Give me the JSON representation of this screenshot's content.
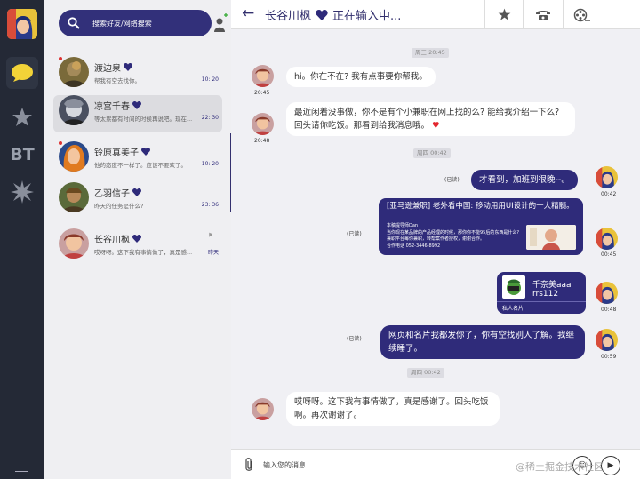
{
  "sidebar": {
    "bt_label": "BT"
  },
  "contacts": {
    "search_placeholder": "搜索好友/网络搜索",
    "items": [
      {
        "name": "渡边泉",
        "message": "帮我有空去找你。",
        "time": "10: 20"
      },
      {
        "name": "凉宫千春",
        "message": "等太累都有时间的时候再说吧。现在...",
        "time": "22: 30"
      },
      {
        "name": "铃原真美子",
        "message": "他的态度不一样了。应该不要欢了。",
        "time": "10: 20"
      },
      {
        "name": "乙羽信子",
        "message": "昨天的任务是什么?",
        "time": "23: 36"
      },
      {
        "name": "长谷川枫",
        "message": "哎呀呀。这下我有事情做了，真是感...",
        "time": "昨天"
      }
    ]
  },
  "chat": {
    "contact_name": "长谷川枫",
    "status": "正在输入中...",
    "input_placeholder": "输入您的消息...",
    "read_label": "(已读)",
    "day_labels": [
      "周三 20:45",
      "周四 00:42",
      "周四 00:42"
    ],
    "messages": [
      {
        "side": "in",
        "text": "hi。你在不在? 我有点事要你帮我。",
        "time": "20:45"
      },
      {
        "side": "in",
        "text": "最近闲着没事做，你不是有个小兼职在网上找的么? 能给我介绍一下么? 回头请你吃饭。那看到给我消息哦。",
        "time": "20:48"
      },
      {
        "side": "out",
        "text": "才看到，加班到很晚--。",
        "time": "00:42"
      },
      {
        "side": "out",
        "text": "网页和名片我都发你了，你有空找别人了解。我继续睡了。",
        "time": "00:59"
      },
      {
        "side": "in",
        "text": "哎呀呀。这下我有事情做了，真是感谢了。回头吃饭啊。再次谢谢了。",
        "time": ""
      }
    ],
    "link_card": {
      "title": "[亚马逊兼职] 老外看中国: 移动用用UI设计的十大精髓。",
      "lines": [
        "本稿提导师Dan",
        "当你现在某品牌的产品经理的时候，那你你不能95后的东西是什么?",
        "兼职平台每你兼职，转帮案作者授权，谢谢合作。",
        "合作电话 052-3446-8992"
      ],
      "time": "00:45"
    },
    "contact_card": {
      "name": "千奈美aaa",
      "id": "rrs112",
      "label": "私人名片",
      "time": "00:48"
    }
  },
  "watermark": "@稀土掘金技术社区"
}
